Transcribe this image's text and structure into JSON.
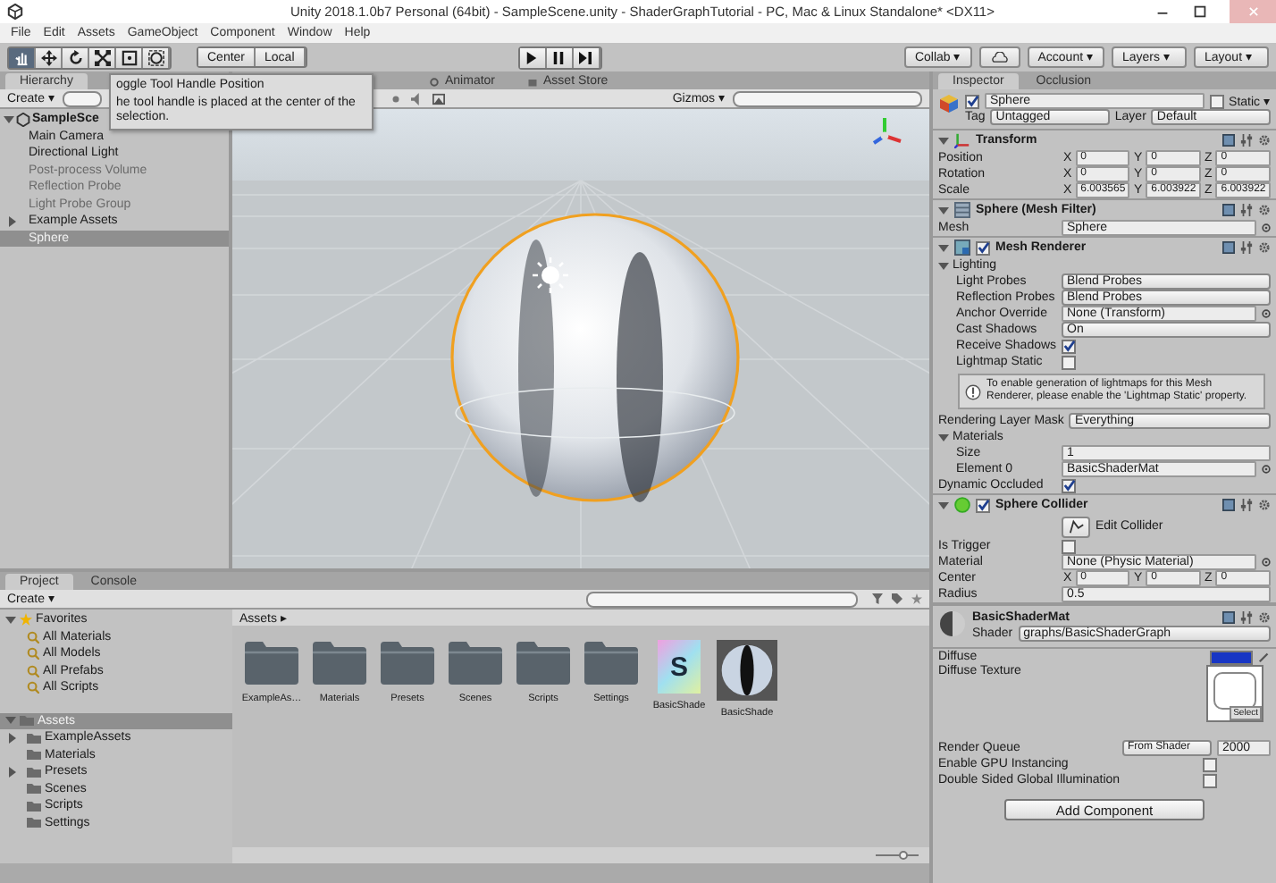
{
  "window": {
    "title": "Unity 2018.1.0b7 Personal (64bit) - SampleScene.unity - ShaderGraphTutorial - PC, Mac & Linux Standalone* <DX11>"
  },
  "menu": [
    "File",
    "Edit",
    "Assets",
    "GameObject",
    "Component",
    "Window",
    "Help"
  ],
  "toolbar": {
    "tools": [
      {
        "kind": "hand",
        "selected": true
      },
      {
        "kind": "move",
        "selected": false
      },
      {
        "kind": "rotate",
        "selected": false
      },
      {
        "kind": "scale",
        "selected": false
      },
      {
        "kind": "rect",
        "selected": false
      },
      {
        "kind": "transform",
        "selected": false
      }
    ],
    "pivot": [
      "Center",
      "Local"
    ],
    "collab": "Collab ▾",
    "account": "Account ▾",
    "layers": "Layers ▾",
    "layout": "Layout ▾"
  },
  "tooltip": {
    "title": "oggle Tool Handle Position",
    "body": "he tool handle is placed at the center of the selection."
  },
  "hierarchy": {
    "tab": "Hierarchy",
    "create": "Create ▾",
    "scene": {
      "label": "SampleSce",
      "expanded": true,
      "children": [
        {
          "label": "Main Camera",
          "selected": false,
          "disabled": false
        },
        {
          "label": "Directional Light",
          "selected": false,
          "disabled": false
        },
        {
          "label": "Post-process Volume",
          "selected": false,
          "disabled": true
        },
        {
          "label": "Reflection Probe",
          "selected": false,
          "disabled": true
        },
        {
          "label": "Light Probe Group",
          "selected": false,
          "disabled": true
        },
        {
          "label": "Example Assets",
          "selected": false,
          "disabled": false,
          "expanded": false
        },
        {
          "label": "Sphere",
          "selected": true,
          "disabled": false
        }
      ]
    }
  },
  "scene_view": {
    "tabs": [
      "Animator",
      "Asset Store"
    ],
    "gizmos": "Gizmos ▾"
  },
  "inspector": {
    "tabs": [
      {
        "label": "Inspector",
        "selected": true
      },
      {
        "label": "Occlusion",
        "selected": false
      }
    ],
    "object": {
      "active": true,
      "name": "Sphere",
      "static": false,
      "static_label": "Static ▾",
      "tag_label": "Tag",
      "tag": "Untagged",
      "layer_label": "Layer",
      "layer": "Default"
    },
    "components": [
      {
        "kind": "transform",
        "title": "Transform",
        "expanded": true,
        "rows": [
          {
            "kind": "vector",
            "label": "Position",
            "values": [
              {
                "axis": "X",
                "value": "0"
              },
              {
                "axis": "Y",
                "value": "0"
              },
              {
                "axis": "Z",
                "value": "0"
              }
            ]
          },
          {
            "kind": "vector",
            "label": "Rotation",
            "values": [
              {
                "axis": "X",
                "value": "0"
              },
              {
                "axis": "Y",
                "value": "0"
              },
              {
                "axis": "Z",
                "value": "0"
              }
            ]
          },
          {
            "kind": "vector",
            "label": "Scale",
            "values": [
              {
                "axis": "X",
                "value": "6.003565"
              },
              {
                "axis": "Y",
                "value": "6.003922"
              },
              {
                "axis": "Z",
                "value": "6.003922"
              }
            ]
          }
        ]
      },
      {
        "kind": "mesh_filter",
        "title": "Sphere (Mesh Filter)",
        "expanded": true,
        "rows": [
          {
            "kind": "object",
            "label": "Mesh",
            "value": "Sphere"
          }
        ]
      },
      {
        "kind": "mesh_renderer",
        "title": "Mesh Renderer",
        "enabled": true,
        "expanded": true,
        "rows": [
          {
            "kind": "foldout",
            "label": "Lighting",
            "expanded": true,
            "children": [
              {
                "kind": "dropdown",
                "label": "Light Probes",
                "value": "Blend Probes"
              },
              {
                "kind": "dropdown",
                "label": "Reflection Probes",
                "value": "Blend Probes"
              },
              {
                "kind": "object",
                "label": "Anchor Override",
                "value": "None (Transform)"
              },
              {
                "kind": "dropdown",
                "label": "Cast Shadows",
                "value": "On"
              },
              {
                "kind": "checkbox",
                "label": "Receive Shadows",
                "checked": true
              },
              {
                "kind": "checkbox",
                "label": "Lightmap Static",
                "checked": false
              },
              {
                "kind": "info",
                "text": "To enable generation of lightmaps for this Mesh Renderer, please enable the 'Lightmap Static' property."
              }
            ]
          },
          {
            "kind": "dropdown",
            "label": "Rendering Layer Mask",
            "value": "Everything"
          },
          {
            "kind": "foldout",
            "label": "Materials",
            "expanded": true,
            "children": [
              {
                "kind": "field",
                "label": "Size",
                "value": "1"
              },
              {
                "kind": "object",
                "label": "Element 0",
                "value": "BasicShaderMat"
              }
            ]
          },
          {
            "kind": "checkbox",
            "label": "Dynamic Occluded",
            "checked": true
          }
        ]
      },
      {
        "kind": "sphere_collider",
        "title": "Sphere Collider",
        "enabled": true,
        "expanded": true,
        "rows": [
          {
            "kind": "button",
            "label": "Edit Collider"
          },
          {
            "kind": "checkbox",
            "label": "Is Trigger",
            "checked": false
          },
          {
            "kind": "object",
            "label": "Material",
            "value": "None (Physic Material)"
          },
          {
            "kind": "vector",
            "label": "Center",
            "values": [
              {
                "axis": "X",
                "value": "0"
              },
              {
                "axis": "Y",
                "value": "0"
              },
              {
                "axis": "Z",
                "value": "0"
              }
            ]
          },
          {
            "kind": "field",
            "label": "Radius",
            "value": "0.5"
          }
        ]
      }
    ],
    "material": {
      "title": "BasicShaderMat",
      "shader_label": "Shader",
      "shader": "graphs/BasicShaderGraph",
      "rows": [
        {
          "kind": "color",
          "label": "Diffuse",
          "color": "#1836c4"
        },
        {
          "kind": "texture",
          "label": "Diffuse Texture",
          "button": "Select"
        },
        {
          "kind": "queue",
          "label": "Render Queue",
          "mode": "From Shader",
          "value": "2000"
        },
        {
          "kind": "checkbox",
          "label": "Enable GPU Instancing",
          "checked": false
        },
        {
          "kind": "checkbox",
          "label": "Double Sided Global Illumination",
          "checked": false
        }
      ]
    },
    "add_component": "Add Component"
  },
  "project": {
    "tabs": [
      {
        "label": "Project",
        "selected": true
      },
      {
        "label": "Console",
        "selected": false
      }
    ],
    "create": "Create ▾",
    "favorites": {
      "label": "Favorites",
      "expanded": true,
      "children": [
        {
          "label": "All Materials"
        },
        {
          "label": "All Models"
        },
        {
          "label": "All Prefabs"
        },
        {
          "label": "All Scripts"
        }
      ]
    },
    "assets": {
      "label": "Assets",
      "expanded": true,
      "selected": true,
      "children": [
        {
          "label": "ExampleAssets",
          "expanded": false
        },
        {
          "label": "Materials"
        },
        {
          "label": "Presets",
          "expanded": false
        },
        {
          "label": "Scenes"
        },
        {
          "label": "Scripts"
        },
        {
          "label": "Settings"
        }
      ]
    },
    "breadcrumb": "Assets ▸",
    "items": [
      {
        "kind": "folder",
        "label": "ExampleAs…"
      },
      {
        "kind": "folder",
        "label": "Materials"
      },
      {
        "kind": "folder",
        "label": "Presets"
      },
      {
        "kind": "folder",
        "label": "Scenes"
      },
      {
        "kind": "folder",
        "label": "Scripts"
      },
      {
        "kind": "folder",
        "label": "Settings"
      },
      {
        "kind": "shader",
        "label": "BasicShade",
        "glyph": "S"
      },
      {
        "kind": "material",
        "label": "BasicShade"
      }
    ],
    "zoom": {
      "level": 0.65
    }
  }
}
